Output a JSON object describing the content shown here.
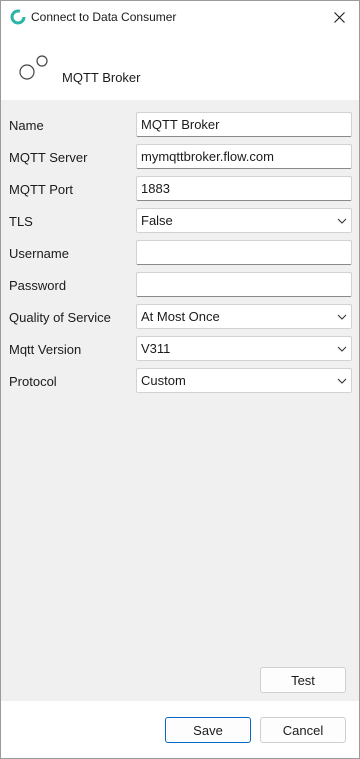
{
  "window": {
    "title": "Connect to Data Consumer"
  },
  "header": {
    "title": "MQTT Broker"
  },
  "form": {
    "name": {
      "label": "Name",
      "value": "MQTT Broker"
    },
    "server": {
      "label": "MQTT Server",
      "value": "mymqttbroker.flow.com"
    },
    "port": {
      "label": "MQTT Port",
      "value": "1883"
    },
    "tls": {
      "label": "TLS",
      "value": "False"
    },
    "username": {
      "label": "Username",
      "value": ""
    },
    "password": {
      "label": "Password",
      "value": ""
    },
    "qos": {
      "label": "Quality of Service",
      "value": "At Most Once"
    },
    "version": {
      "label": "Mqtt Version",
      "value": "V311"
    },
    "protocol": {
      "label": "Protocol",
      "value": "Custom"
    }
  },
  "buttons": {
    "test": "Test",
    "save": "Save",
    "cancel": "Cancel"
  },
  "colors": {
    "accent": "#0a67c2",
    "app_icon_teal": "#2bb5a8",
    "panel": "#f0f0f0"
  },
  "icons": {
    "app": "app-logo-icon",
    "close": "close-icon",
    "broker": "mqtt-broker-icon",
    "dropdown": "chevron-down-icon"
  }
}
